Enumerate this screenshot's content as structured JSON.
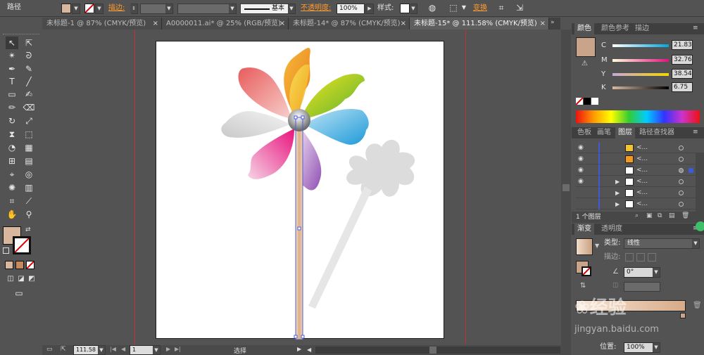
{
  "control_bar": {
    "object_type": "路径",
    "stroke_label": "描边:",
    "stroke_style": "基本",
    "opacity_label": "不透明度:",
    "opacity_value": "100%",
    "style_label": "样式:",
    "transform_label": "变换"
  },
  "tabs": [
    {
      "label": "未标题-1 @ 87% (CMYK/预览)",
      "active": false
    },
    {
      "label": "A0000011.ai* @ 25% (RGB/预览)",
      "active": false
    },
    {
      "label": "未标题-14* @ 87% (CMYK/预览)",
      "active": false
    },
    {
      "label": "未标题-15* @ 111.58% (CMYK/预览)",
      "active": true
    }
  ],
  "tab_close": "×",
  "color_panel": {
    "tabs": [
      "颜色",
      "颜色参考",
      "描边"
    ],
    "channels": [
      {
        "name": "C",
        "value": "21.83"
      },
      {
        "name": "M",
        "value": "32.76"
      },
      {
        "name": "Y",
        "value": "38.54"
      },
      {
        "name": "K",
        "value": "6.75"
      }
    ],
    "swatch_color": "#c9a38a"
  },
  "layers_panel": {
    "tabs": [
      "色板",
      "画笔",
      "图层",
      "路径查找器"
    ],
    "active_tab": "图层",
    "rows": [
      {
        "name": "<...",
        "expandable": false
      },
      {
        "name": "<...",
        "expandable": false
      },
      {
        "name": "<...",
        "expandable": false
      },
      {
        "name": "<...",
        "expandable": true
      },
      {
        "name": "<...",
        "expandable": true
      },
      {
        "name": "<...",
        "expandable": true
      }
    ],
    "footer_label": "1 个图层"
  },
  "gradient_panel": {
    "tabs": [
      "渐变",
      "透明度"
    ],
    "type_label": "类型:",
    "type_value": "线性",
    "stroke_label": "描边:",
    "angle_value": "0°",
    "position_label": "位置:",
    "position_value": "100%"
  },
  "status_bar": {
    "zoom": "111.58",
    "page": "1",
    "tool_name": "选择"
  },
  "watermark": {
    "text": "经验",
    "url": "jingyan.baidu.com"
  }
}
